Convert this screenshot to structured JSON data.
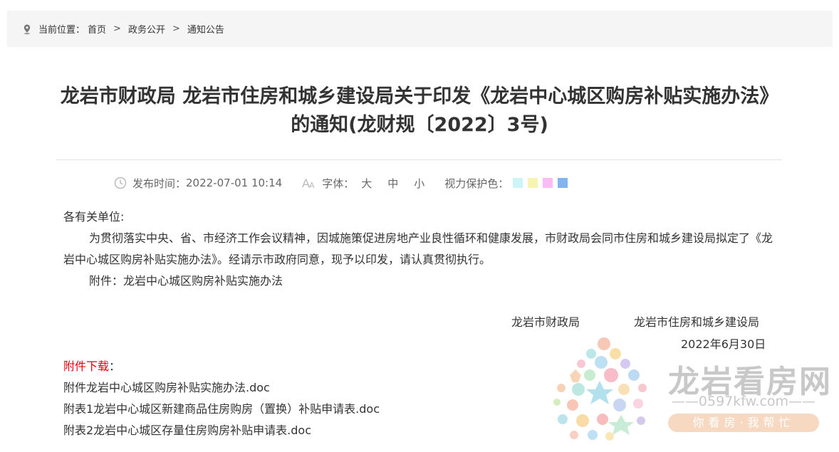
{
  "breadcrumb": {
    "prefix": "当前位置：",
    "items": [
      "首页",
      "政务公开",
      "通知公告"
    ],
    "separator": ">"
  },
  "article": {
    "title": "龙岩市财政局 龙岩市住房和城乡建设局关于印发《龙岩中心城区购房补贴实施办法》的通知(龙财规〔2022〕3号)",
    "publish_label": "发布时间：",
    "publish_time": "2022-07-01 10:14",
    "font_label": "字体：",
    "font_sizes": [
      "大",
      "中",
      "小"
    ],
    "eye_label": "视力保护色：",
    "eye_colors": [
      "#ccf5f7",
      "#f5f5b0",
      "#fbbcf5",
      "#82b4f2",
      "#ffffff"
    ],
    "salutation": "各有关单位:",
    "paragraph": "为贯彻落实中央、省、市经济工作会议精神，因城施策促进房地产业良性循环和健康发展，市财政局会同市住房和城乡建设局拟定了《龙岩中心城区购房补贴实施办法》。经请示市政府同意，现予以印发，请认真贯彻执行。",
    "attachment_note": "附件：龙岩中心城区购房补贴实施办法",
    "signer_1": "龙岩市财政局",
    "signer_2": "龙岩市住房和城乡建设局",
    "date": "2022年6月30日"
  },
  "attachments": {
    "label": "附件下载",
    "colon": "：",
    "files": [
      "附件龙岩中心城区购房补贴实施办法.doc",
      "附表1龙岩中心城区新建商品住房购房（置换）补贴申请表.doc",
      "附表2龙岩中心城区存量住房购房补贴申请表.doc"
    ]
  },
  "watermark": {
    "title": "龙岩看房网",
    "url": "——0597kfw.com——",
    "slogan": "你看房·我帮忙"
  }
}
